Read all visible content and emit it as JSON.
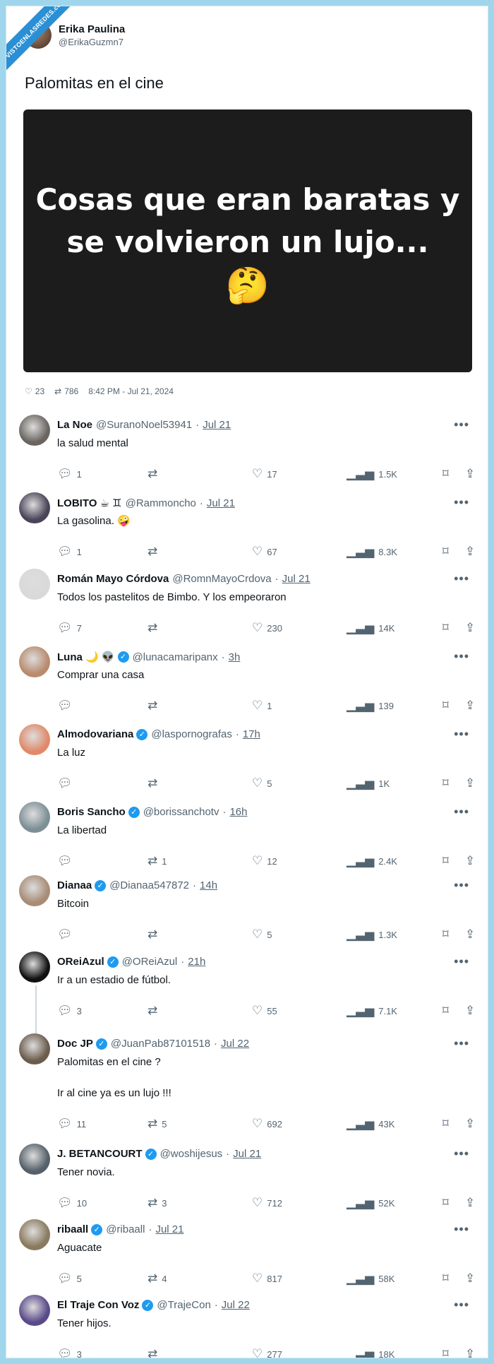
{
  "watermark": "VISTOENLASREDES.com",
  "author": {
    "name": "Erika Paulina",
    "handle": "@ErikaGuzmn7",
    "text": "Palomitas en el cine"
  },
  "media": {
    "caption_line1": "Cosas que eran baratas y",
    "caption_line2": "se volvieron un lujo...",
    "emoji": "🤔"
  },
  "stats": {
    "likes": "23",
    "retweets": "786",
    "datetime": "8:42 PM - Jul 21, 2024"
  },
  "replies": [
    {
      "name": "La Noe",
      "verified": false,
      "handle": "@SuranoNoel53941",
      "date": "Jul 21",
      "text": [
        "la salud mental"
      ],
      "replies": "1",
      "retweets": "",
      "likes": "17",
      "views": "1.5K",
      "avatar_color": "#6a6560"
    },
    {
      "name": "LOBITO ☕ ♊",
      "verified": false,
      "handle": "@Rammoncho",
      "date": "Jul 21",
      "text": [
        "La gasolina. 🤪"
      ],
      "replies": "1",
      "retweets": "",
      "likes": "67",
      "views": "8.3K",
      "avatar_color": "#4a4458"
    },
    {
      "name": "Román Mayo Córdova",
      "verified": false,
      "handle": "@RomnMayoCrdova",
      "date": "Jul 21",
      "text": [
        "Todos los pastelitos de Bimbo. Y los empeoraron"
      ],
      "replies": "7",
      "retweets": "",
      "likes": "230",
      "views": "14K",
      "avatar_color": "#d9d9d9"
    },
    {
      "name": "Luna 🌙 👽",
      "verified": true,
      "handle": "@lunacamaripanx",
      "date": "3h",
      "text": [
        "Comprar una casa"
      ],
      "replies": "",
      "retweets": "",
      "likes": "1",
      "views": "139",
      "avatar_color": "#b98b6e"
    },
    {
      "name": "Almodovariana",
      "verified": true,
      "handle": "@laspornografas",
      "date": "17h",
      "text": [
        "La luz"
      ],
      "replies": "",
      "retweets": "",
      "likes": "5",
      "views": "1K",
      "avatar_color": "#e08a6a"
    },
    {
      "name": "Boris Sancho",
      "verified": true,
      "handle": "@borissanchotv",
      "date": "16h",
      "text": [
        "La libertad"
      ],
      "replies": "",
      "retweets": "1",
      "likes": "12",
      "views": "2.4K",
      "avatar_color": "#7d8f96"
    },
    {
      "name": "Dianaa",
      "verified": true,
      "handle": "@Dianaa547872",
      "date": "14h",
      "text": [
        "Bitcoin"
      ],
      "replies": "",
      "retweets": "",
      "likes": "5",
      "views": "1.3K",
      "avatar_color": "#a88c76"
    },
    {
      "name": "OReiAzul",
      "verified": true,
      "handle": "@OReiAzul",
      "date": "21h",
      "text": [
        "Ir a un estadio de fútbol."
      ],
      "replies": "3",
      "retweets": "",
      "likes": "55",
      "views": "7.1K",
      "avatar_color": "#111111"
    },
    {
      "name": "Doc JP",
      "verified": true,
      "handle": "@JuanPab87101518",
      "date": "Jul 22",
      "text": [
        "Palomitas en el cine ?",
        "",
        "Ir al cine ya es un lujo !!!"
      ],
      "replies": "11",
      "retweets": "5",
      "likes": "692",
      "views": "43K",
      "avatar_color": "#6b5c4c"
    },
    {
      "name": "J. BETANCOURT",
      "verified": true,
      "handle": "@woshijesus",
      "date": "Jul 21",
      "text": [
        "Tener novia."
      ],
      "replies": "10",
      "retweets": "3",
      "likes": "712",
      "views": "52K",
      "avatar_color": "#55606a"
    },
    {
      "name": "ribaall",
      "verified": true,
      "handle": "@ribaall",
      "date": "Jul 21",
      "text": [
        "Aguacate"
      ],
      "replies": "5",
      "retweets": "4",
      "likes": "817",
      "views": "58K",
      "avatar_color": "#8a7a5e"
    },
    {
      "name": "El Traje Con Voz",
      "verified": true,
      "handle": "@TrajeCon",
      "date": "Jul 22",
      "text": [
        "Tener hijos."
      ],
      "replies": "3",
      "retweets": "",
      "likes": "277",
      "views": "18K",
      "avatar_color": "#5a4a8a"
    }
  ]
}
